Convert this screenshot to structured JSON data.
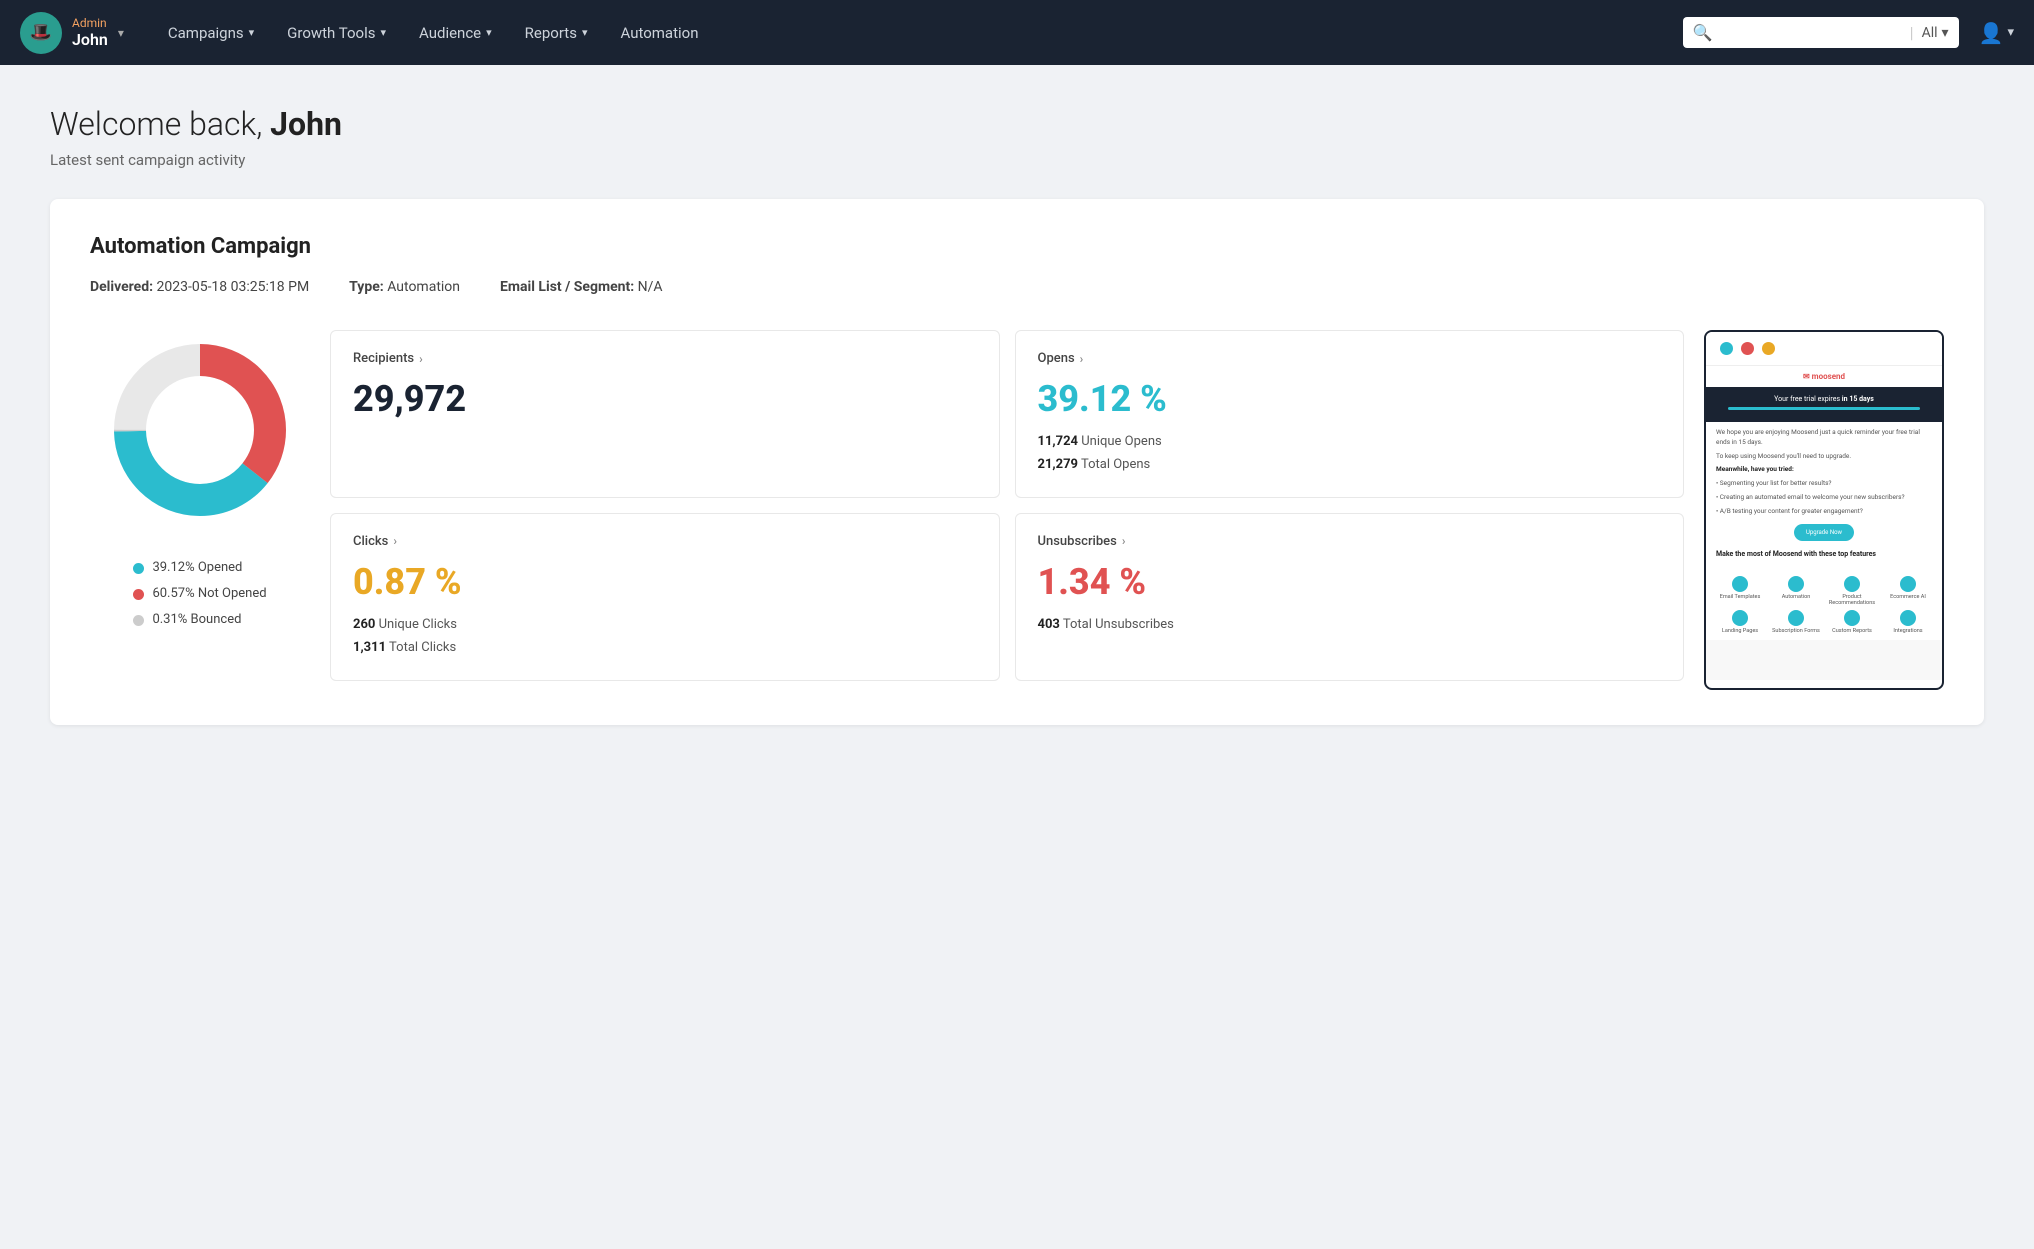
{
  "navbar": {
    "role": "Admin",
    "username": "John",
    "nav_items": [
      {
        "label": "Campaigns",
        "has_dropdown": true
      },
      {
        "label": "Growth Tools",
        "has_dropdown": true
      },
      {
        "label": "Audience",
        "has_dropdown": true
      },
      {
        "label": "Reports",
        "has_dropdown": true
      },
      {
        "label": "Automation",
        "has_dropdown": false
      }
    ],
    "search_placeholder": "",
    "search_filter": "All"
  },
  "page": {
    "welcome": "Welcome back,",
    "username": "John",
    "subtitle": "Latest sent campaign activity"
  },
  "campaign": {
    "title": "Automation Campaign",
    "delivered_label": "Delivered:",
    "delivered_value": "2023-05-18 03:25:18 PM",
    "type_label": "Type:",
    "type_value": "Automation",
    "email_list_label": "Email List / Segment:",
    "email_list_value": "N/A"
  },
  "donut": {
    "opened_pct": 39.12,
    "not_opened_pct": 60.57,
    "bounced_pct": 0.31,
    "legend": [
      {
        "label": "39.12% Opened",
        "color": "#2bbcce"
      },
      {
        "label": "60.57% Not Opened",
        "color": "#e05252"
      },
      {
        "label": "0.31% Bounced",
        "color": "#cccccc"
      }
    ]
  },
  "stats": {
    "recipients": {
      "label": "Recipients",
      "value": "29,972"
    },
    "opens": {
      "label": "Opens",
      "pct": "39.12 %",
      "unique": "11,724",
      "unique_label": "Unique Opens",
      "total": "21,279",
      "total_label": "Total Opens"
    },
    "clicks": {
      "label": "Clicks",
      "pct": "0.87 %",
      "unique": "260",
      "unique_label": "Unique Clicks",
      "total": "1,311",
      "total_label": "Total Clicks"
    },
    "unsubscribes": {
      "label": "Unsubscribes",
      "pct": "1.34 %",
      "total": "403",
      "total_label": "Total Unsubscribes"
    }
  },
  "preview": {
    "trial_text": "Your free trial expires in 15 days",
    "logo": "moosend",
    "upgrade_btn": "Upgrade Now",
    "section_title": "Make the most of Moosend with these top features",
    "features": [
      "Email Templates",
      "Automation",
      "Product Recommendations",
      "Ecommerce AI",
      "Landing Pages",
      "Subscription Forms",
      "Custom Reports",
      "Integrations"
    ]
  }
}
